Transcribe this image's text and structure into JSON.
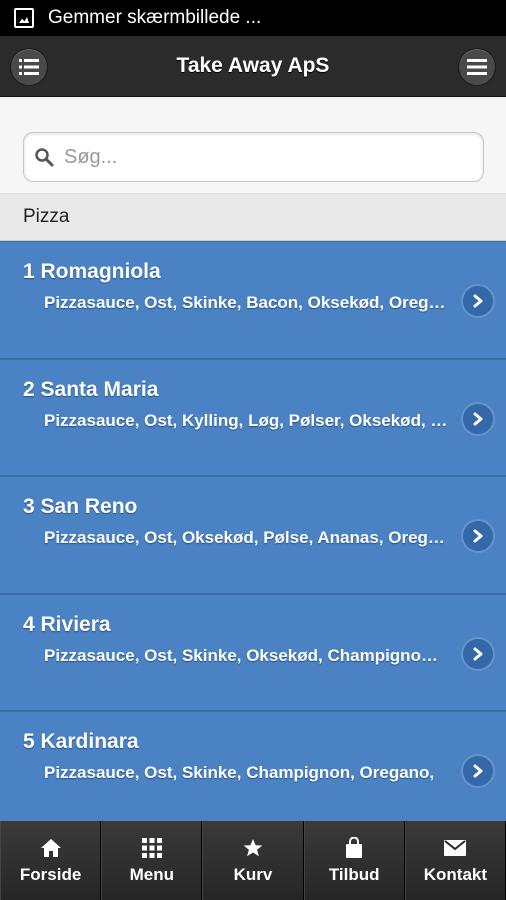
{
  "statusbar": {
    "text": "Gemmer skærmbillede ..."
  },
  "header": {
    "title": "Take Away ApS",
    "left_icon": "list-icon",
    "right_icon": "hamburger-menu-icon"
  },
  "search": {
    "placeholder": "Søg...",
    "value": ""
  },
  "section": {
    "label": "Pizza"
  },
  "items": [
    {
      "name": "1 Romagniola",
      "desc": "Pizzasauce, Ost, Skinke, Bacon, Oksekød, Oregano"
    },
    {
      "name": "2 Santa Maria",
      "desc": "Pizzasauce, Ost, Kylling, Løg, Pølser, Oksekød, Oregano"
    },
    {
      "name": "3 San Reno",
      "desc": "Pizzasauce, Ost, Oksekød, Pølse, Ananas, Oregano"
    },
    {
      "name": "4 Riviera",
      "desc": "Pizzasauce, Ost, Skinke, Oksekød, Champignon, Oregano"
    },
    {
      "name": "5 Kardinara",
      "desc": "Pizzasauce, Ost, Skinke, Champignon, Oregano,"
    }
  ],
  "tabs": [
    {
      "label": "Forside",
      "icon": "home-icon"
    },
    {
      "label": "Menu",
      "icon": "grid-icon"
    },
    {
      "label": "Kurv",
      "icon": "star-icon"
    },
    {
      "label": "Tilbud",
      "icon": "shopping-bag-icon"
    },
    {
      "label": "Kontakt",
      "icon": "mail-icon"
    }
  ],
  "colors": {
    "header": "#2b2b2b",
    "item_bg": "#4a82c4",
    "tabbar": "#1e1e1e"
  }
}
